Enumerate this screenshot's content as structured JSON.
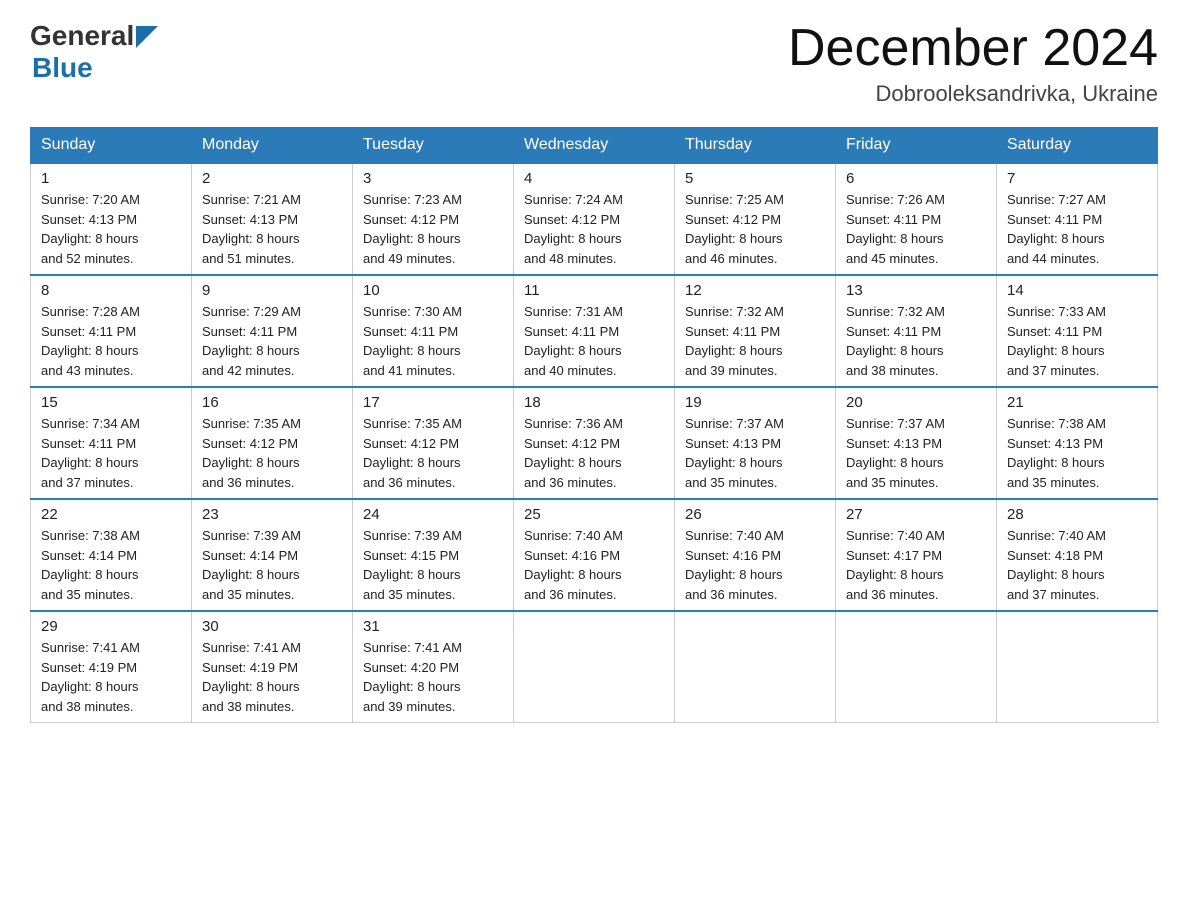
{
  "header": {
    "logo_general": "General",
    "logo_blue": "Blue",
    "month_title": "December 2024",
    "location": "Dobrooleksandrivka, Ukraine"
  },
  "weekdays": [
    "Sunday",
    "Monday",
    "Tuesday",
    "Wednesday",
    "Thursday",
    "Friday",
    "Saturday"
  ],
  "weeks": [
    [
      {
        "day": "1",
        "sunrise": "7:20 AM",
        "sunset": "4:13 PM",
        "daylight": "8 hours and 52 minutes."
      },
      {
        "day": "2",
        "sunrise": "7:21 AM",
        "sunset": "4:13 PM",
        "daylight": "8 hours and 51 minutes."
      },
      {
        "day": "3",
        "sunrise": "7:23 AM",
        "sunset": "4:12 PM",
        "daylight": "8 hours and 49 minutes."
      },
      {
        "day": "4",
        "sunrise": "7:24 AM",
        "sunset": "4:12 PM",
        "daylight": "8 hours and 48 minutes."
      },
      {
        "day": "5",
        "sunrise": "7:25 AM",
        "sunset": "4:12 PM",
        "daylight": "8 hours and 46 minutes."
      },
      {
        "day": "6",
        "sunrise": "7:26 AM",
        "sunset": "4:11 PM",
        "daylight": "8 hours and 45 minutes."
      },
      {
        "day": "7",
        "sunrise": "7:27 AM",
        "sunset": "4:11 PM",
        "daylight": "8 hours and 44 minutes."
      }
    ],
    [
      {
        "day": "8",
        "sunrise": "7:28 AM",
        "sunset": "4:11 PM",
        "daylight": "8 hours and 43 minutes."
      },
      {
        "day": "9",
        "sunrise": "7:29 AM",
        "sunset": "4:11 PM",
        "daylight": "8 hours and 42 minutes."
      },
      {
        "day": "10",
        "sunrise": "7:30 AM",
        "sunset": "4:11 PM",
        "daylight": "8 hours and 41 minutes."
      },
      {
        "day": "11",
        "sunrise": "7:31 AM",
        "sunset": "4:11 PM",
        "daylight": "8 hours and 40 minutes."
      },
      {
        "day": "12",
        "sunrise": "7:32 AM",
        "sunset": "4:11 PM",
        "daylight": "8 hours and 39 minutes."
      },
      {
        "day": "13",
        "sunrise": "7:32 AM",
        "sunset": "4:11 PM",
        "daylight": "8 hours and 38 minutes."
      },
      {
        "day": "14",
        "sunrise": "7:33 AM",
        "sunset": "4:11 PM",
        "daylight": "8 hours and 37 minutes."
      }
    ],
    [
      {
        "day": "15",
        "sunrise": "7:34 AM",
        "sunset": "4:11 PM",
        "daylight": "8 hours and 37 minutes."
      },
      {
        "day": "16",
        "sunrise": "7:35 AM",
        "sunset": "4:12 PM",
        "daylight": "8 hours and 36 minutes."
      },
      {
        "day": "17",
        "sunrise": "7:35 AM",
        "sunset": "4:12 PM",
        "daylight": "8 hours and 36 minutes."
      },
      {
        "day": "18",
        "sunrise": "7:36 AM",
        "sunset": "4:12 PM",
        "daylight": "8 hours and 36 minutes."
      },
      {
        "day": "19",
        "sunrise": "7:37 AM",
        "sunset": "4:13 PM",
        "daylight": "8 hours and 35 minutes."
      },
      {
        "day": "20",
        "sunrise": "7:37 AM",
        "sunset": "4:13 PM",
        "daylight": "8 hours and 35 minutes."
      },
      {
        "day": "21",
        "sunrise": "7:38 AM",
        "sunset": "4:13 PM",
        "daylight": "8 hours and 35 minutes."
      }
    ],
    [
      {
        "day": "22",
        "sunrise": "7:38 AM",
        "sunset": "4:14 PM",
        "daylight": "8 hours and 35 minutes."
      },
      {
        "day": "23",
        "sunrise": "7:39 AM",
        "sunset": "4:14 PM",
        "daylight": "8 hours and 35 minutes."
      },
      {
        "day": "24",
        "sunrise": "7:39 AM",
        "sunset": "4:15 PM",
        "daylight": "8 hours and 35 minutes."
      },
      {
        "day": "25",
        "sunrise": "7:40 AM",
        "sunset": "4:16 PM",
        "daylight": "8 hours and 36 minutes."
      },
      {
        "day": "26",
        "sunrise": "7:40 AM",
        "sunset": "4:16 PM",
        "daylight": "8 hours and 36 minutes."
      },
      {
        "day": "27",
        "sunrise": "7:40 AM",
        "sunset": "4:17 PM",
        "daylight": "8 hours and 36 minutes."
      },
      {
        "day": "28",
        "sunrise": "7:40 AM",
        "sunset": "4:18 PM",
        "daylight": "8 hours and 37 minutes."
      }
    ],
    [
      {
        "day": "29",
        "sunrise": "7:41 AM",
        "sunset": "4:19 PM",
        "daylight": "8 hours and 38 minutes."
      },
      {
        "day": "30",
        "sunrise": "7:41 AM",
        "sunset": "4:19 PM",
        "daylight": "8 hours and 38 minutes."
      },
      {
        "day": "31",
        "sunrise": "7:41 AM",
        "sunset": "4:20 PM",
        "daylight": "8 hours and 39 minutes."
      },
      null,
      null,
      null,
      null
    ]
  ],
  "labels": {
    "sunrise": "Sunrise:",
    "sunset": "Sunset:",
    "daylight": "Daylight:"
  }
}
